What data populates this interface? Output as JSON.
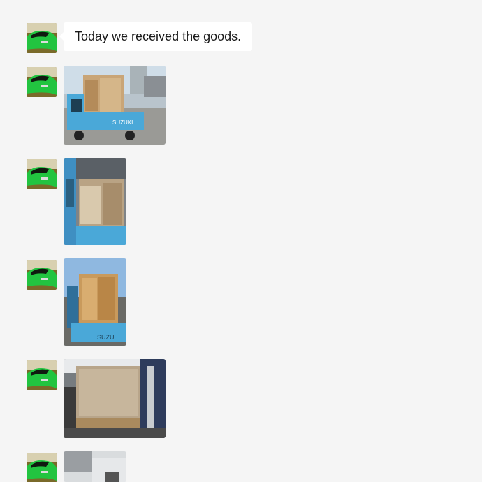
{
  "messages": [
    {
      "type": "text",
      "text": "Today we received the goods.",
      "avatar_icon": "sports-car-avatar-icon"
    },
    {
      "type": "image",
      "description_icon": "truck-loaded-boxes-photo-icon"
    },
    {
      "type": "image",
      "description_icon": "truck-side-boxes-photo-icon"
    },
    {
      "type": "image",
      "description_icon": "truck-rear-boxes-photo-icon"
    },
    {
      "type": "image",
      "description_icon": "pallet-boxes-photo-icon"
    },
    {
      "type": "image",
      "description_icon": "outdoor-photo-icon"
    }
  ],
  "colors": {
    "background": "#f5f5f5",
    "bubble": "#ffffff",
    "avatar_car": "#22c440",
    "truck_blue": "#4aa8d8"
  }
}
